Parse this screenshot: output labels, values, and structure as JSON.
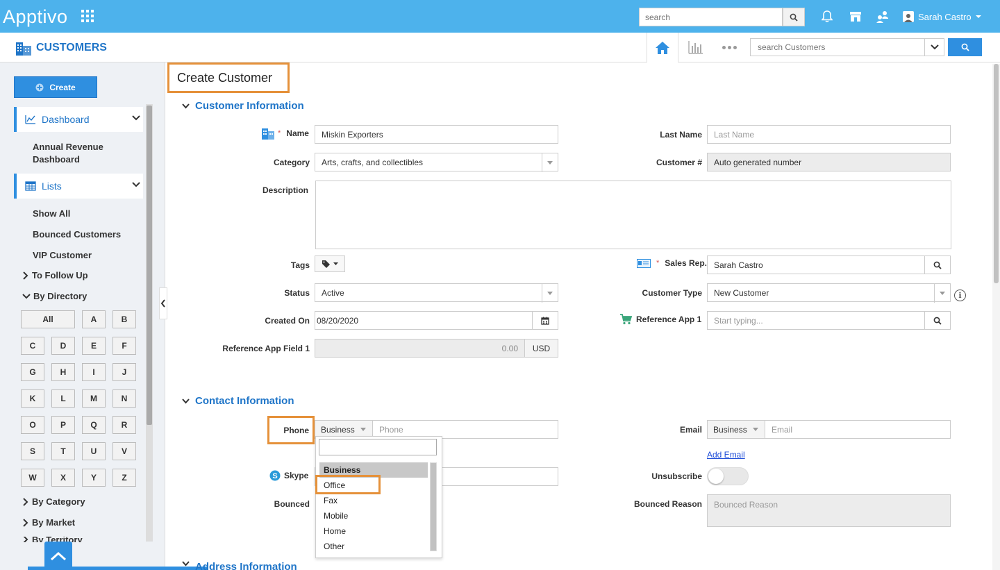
{
  "topbar": {
    "logo": "Apptivo",
    "search_placeholder": "search",
    "user_name": "Sarah Castro"
  },
  "app": {
    "title": "CUSTOMERS",
    "search_placeholder": "search Customers"
  },
  "sidebar": {
    "create_label": "Create",
    "dashboard_label": "Dashboard",
    "dashboard_items": [
      "Annual Revenue Dashboard"
    ],
    "lists_label": "Lists",
    "lists_items": [
      "Show All",
      "Bounced Customers",
      "VIP Customer"
    ],
    "to_follow_up": "To Follow Up",
    "by_directory": "By Directory",
    "directory_letters": [
      "All",
      "A",
      "B",
      "C",
      "D",
      "E",
      "F",
      "G",
      "H",
      "I",
      "J",
      "K",
      "L",
      "M",
      "N",
      "O",
      "P",
      "Q",
      "R",
      "S",
      "T",
      "U",
      "V",
      "W",
      "X",
      "Y",
      "Z"
    ],
    "by_category": "By Category",
    "by_market": "By Market",
    "by_territory_partial": "By Territory"
  },
  "form": {
    "title": "Create Customer",
    "customer_info_header": "Customer Information",
    "name_label": "Name",
    "name_value": "Miskin Exporters",
    "last_name_label": "Last Name",
    "last_name_placeholder": "Last Name",
    "category_label": "Category",
    "category_value": "Arts, crafts, and collectibles",
    "customer_num_label": "Customer #",
    "customer_num_value": "Auto generated number",
    "description_label": "Description",
    "tags_label": "Tags",
    "sales_rep_label": "Sales Rep.",
    "sales_rep_value": "Sarah Castro",
    "status_label": "Status",
    "status_value": "Active",
    "customer_type_label": "Customer Type",
    "customer_type_value": "New Customer",
    "created_on_label": "Created On",
    "created_on_value": "08/20/2020",
    "reference_app_label": "Reference App 1",
    "reference_app_placeholder": "Start typing...",
    "ref_field_label": "Reference App Field 1",
    "ref_field_value": "0.00",
    "ref_field_currency": "USD",
    "contact_info_header": "Contact Information",
    "phone_label": "Phone",
    "phone_type": "Business",
    "phone_placeholder": "Phone",
    "email_label": "Email",
    "email_type": "Business",
    "email_placeholder": "Email",
    "add_email": "Add Email",
    "skype_label": "Skype",
    "unsubscribe_label": "Unsubscribe",
    "bounced_label": "Bounced",
    "bounced_reason_label": "Bounced Reason",
    "bounced_reason_placeholder": "Bounced Reason",
    "address_info_header": "Address Information"
  },
  "phone_dropdown": {
    "search_value": "",
    "options": [
      "Business",
      "Office",
      "Fax",
      "Mobile",
      "Home",
      "Other"
    ],
    "selected": "Business",
    "highlighted": "Office"
  },
  "colors": {
    "topbar": "#4db2ec",
    "accent": "#2f8fe0",
    "highlight_box": "#e5913a"
  }
}
